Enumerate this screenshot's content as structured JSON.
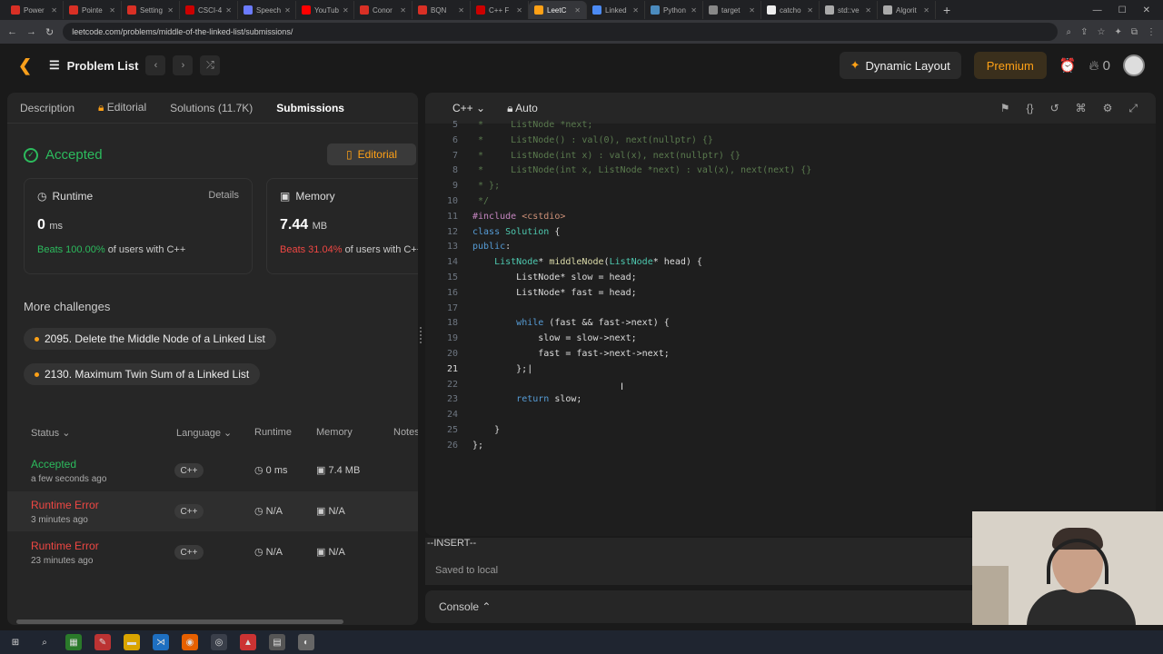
{
  "browser": {
    "tabs": [
      {
        "label": "Power",
        "color": "#d93025"
      },
      {
        "label": "Pointe",
        "color": "#d93025"
      },
      {
        "label": "Setting",
        "color": "#d93025"
      },
      {
        "label": "CSCI-4",
        "color": "#c00"
      },
      {
        "label": "Speech",
        "color": "#6b7bff"
      },
      {
        "label": "YouTub",
        "color": "#f00"
      },
      {
        "label": "Conor",
        "color": "#d93025"
      },
      {
        "label": "BQN",
        "color": "#d93025"
      },
      {
        "label": "C++ F",
        "color": "#c00"
      },
      {
        "label": "LeetC",
        "color": "#ffa116",
        "active": true
      },
      {
        "label": "Linked",
        "color": "#4c8bf5"
      },
      {
        "label": "Python",
        "color": "#4b8bbe"
      },
      {
        "label": "target",
        "color": "#888"
      },
      {
        "label": "catcho",
        "color": "#eee"
      },
      {
        "label": "std::ve",
        "color": "#aaa"
      },
      {
        "label": "Algorit",
        "color": "#aaa"
      }
    ],
    "url": "leetcode.com/problems/middle-of-the-linked-list/submissions/"
  },
  "topnav": {
    "problem_list": "Problem List",
    "dynamic_layout": "Dynamic Layout",
    "premium": "Premium",
    "streak": "0"
  },
  "left": {
    "tabs": {
      "description": "Description",
      "editorial": "Editorial",
      "solutions": "Solutions (11.7K)",
      "submissions": "Submissions"
    },
    "result": "Accepted",
    "editorial_btn": "Editorial",
    "runtime": {
      "title": "Runtime",
      "details": "Details",
      "value": "0",
      "unit": "ms",
      "beats": "Beats 100.00%",
      "beats_tail": "of users with C++"
    },
    "memory": {
      "title": "Memory",
      "value": "7.44",
      "unit": "MB",
      "beats": "Beats 31.04%",
      "beats_tail": "of users with C++"
    },
    "more_challenges": "More challenges",
    "challenges": [
      "2095. Delete the Middle Node of a Linked List",
      "2130. Maximum Twin Sum of a Linked List"
    ],
    "table_headers": {
      "status": "Status",
      "language": "Language",
      "runtime": "Runtime",
      "memory": "Memory",
      "notes": "Notes"
    },
    "submissions": [
      {
        "status": "Accepted",
        "time": "a few seconds ago",
        "lang": "C++",
        "runtime": "0 ms",
        "memory": "7.4 MB",
        "color": "#2cbb5d"
      },
      {
        "status": "Runtime Error",
        "time": "3 minutes ago",
        "lang": "C++",
        "runtime": "N/A",
        "memory": "N/A",
        "color": "#ef4743"
      },
      {
        "status": "Runtime Error",
        "time": "23 minutes ago",
        "lang": "C++",
        "runtime": "N/A",
        "memory": "N/A",
        "color": "#ef4743"
      }
    ]
  },
  "editor": {
    "language": "C++",
    "mode": "Auto",
    "status": "--INSERT--",
    "saved": "Saved to local",
    "console": "Console",
    "lines": [
      {
        "n": "5",
        "html": "<span class='cm'> *     ListNode *next;</span>"
      },
      {
        "n": "6",
        "html": "<span class='cm'> *     ListNode() : val(0), next(nullptr) {}</span>"
      },
      {
        "n": "7",
        "html": "<span class='cm'> *     ListNode(int x) : val(x), next(nullptr) {}</span>"
      },
      {
        "n": "8",
        "html": "<span class='cm'> *     ListNode(int x, ListNode *next) : val(x), next(next) {}</span>"
      },
      {
        "n": "9",
        "html": "<span class='cm'> * };</span>"
      },
      {
        "n": "10",
        "html": "<span class='cm'> */</span>"
      },
      {
        "n": "11",
        "html": "<span class='pp'>#include</span> <span class='st2'>&lt;cstdio&gt;</span>"
      },
      {
        "n": "12",
        "html": "<span class='kw'>class</span> <span class='ty'>Solution</span> {"
      },
      {
        "n": "13",
        "html": "<span class='kw'>public</span>:"
      },
      {
        "n": "14",
        "html": "    <span class='ty'>ListNode</span>* <span class='fn'>middleNode</span>(<span class='ty'>ListNode</span>* head) {"
      },
      {
        "n": "15",
        "html": "        ListNode* slow = head;"
      },
      {
        "n": "16",
        "html": "        ListNode* fast = head;"
      },
      {
        "n": "17",
        "html": ""
      },
      {
        "n": "18",
        "html": "        <span class='kw'>while</span> (fast &amp;&amp; fast-&gt;next) {"
      },
      {
        "n": "19",
        "html": "            slow = slow-&gt;next;"
      },
      {
        "n": "20",
        "html": "            fast = fast-&gt;next-&gt;next;"
      },
      {
        "n": "21",
        "html": "        };|",
        "current": true
      },
      {
        "n": "22",
        "html": ""
      },
      {
        "n": "23",
        "html": "        <span class='kw'>return</span> slow;"
      },
      {
        "n": "24",
        "html": ""
      },
      {
        "n": "25",
        "html": "    }"
      },
      {
        "n": "26",
        "html": "};"
      }
    ]
  }
}
